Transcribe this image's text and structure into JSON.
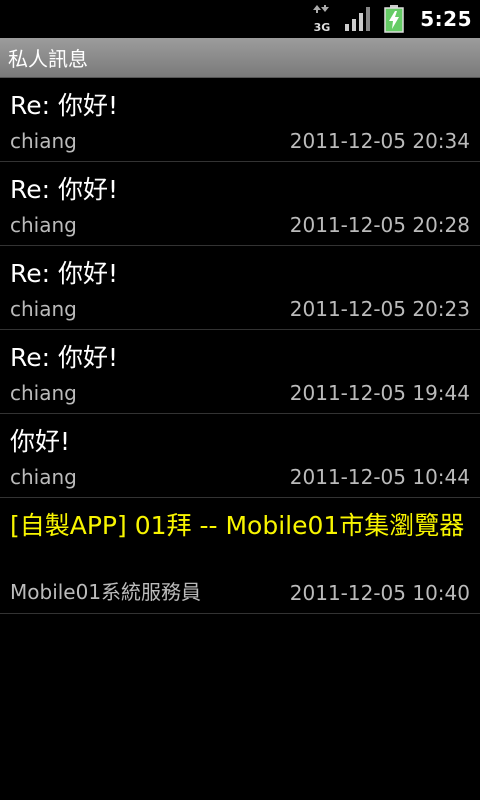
{
  "status_bar": {
    "network_type": "3G",
    "time": "5:25",
    "icons": [
      "data-arrows-icon",
      "signal-strength-icon",
      "battery-charging-icon"
    ]
  },
  "title_bar": {
    "title": "私人訊息"
  },
  "colors": {
    "highlight": "#f8f500",
    "text": "#ffffff",
    "secondary": "#bbbbbb",
    "title_bar": "#8a8a8a",
    "divider": "#333333"
  },
  "messages": [
    {
      "subject": "Re: 你好!",
      "sender": "chiang",
      "date": "2011-12-05 20:34"
    },
    {
      "subject": "Re: 你好!",
      "sender": "chiang",
      "date": "2011-12-05 20:28"
    },
    {
      "subject": "Re: 你好!",
      "sender": "chiang",
      "date": "2011-12-05 20:23"
    },
    {
      "subject": "Re: 你好!",
      "sender": "chiang",
      "date": "2011-12-05 19:44"
    },
    {
      "subject": "你好!",
      "sender": "chiang",
      "date": "2011-12-05 10:44"
    },
    {
      "subject": "[自製APP] 01拜 -- Mobile01市集瀏覽器",
      "sender": "Mobile01系統服務員",
      "date": "2011-12-05 10:40"
    }
  ]
}
